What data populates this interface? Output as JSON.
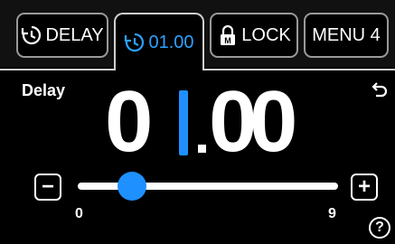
{
  "tabs": [
    {
      "label": "DELAY",
      "icon": "history-icon",
      "active": false
    },
    {
      "label": "01.00",
      "icon": "history-icon",
      "active": true
    },
    {
      "label": "LOCK",
      "icon": "padlock-m-icon",
      "active": false
    },
    {
      "label": "MENU 4",
      "active": false
    }
  ],
  "panel": {
    "title": "Delay",
    "value_digits": [
      "0",
      "1",
      ".",
      "0",
      "0"
    ],
    "accent_color": "#1e90ff"
  },
  "slider": {
    "min_label": "0",
    "max_label": "9",
    "value": 1,
    "min": 0,
    "max": 9,
    "decrement_label": "−",
    "increment_label": "+"
  },
  "help_label": "?"
}
